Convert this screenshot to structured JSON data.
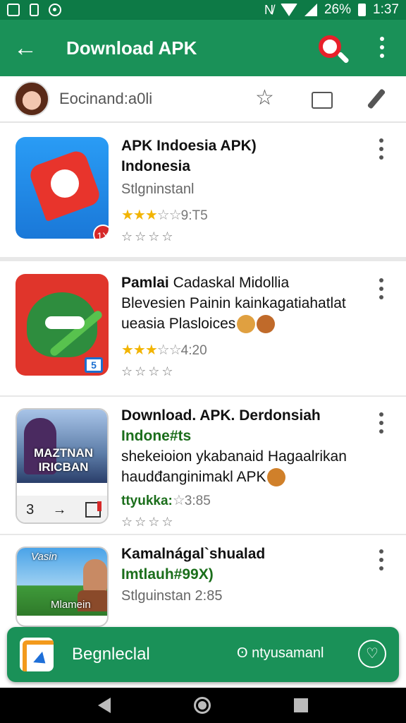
{
  "status_bar": {
    "battery": "26%",
    "time": "1:37"
  },
  "app_bar": {
    "back_icon": "arrow-left-icon",
    "title": "Download APK",
    "search_color": "#e8202a"
  },
  "profile": {
    "name": "Eocinand:a0li"
  },
  "items": [
    {
      "title_lines": [
        "APK Indoesia APK)",
        "Indonesia"
      ],
      "sub": "Stlgninstanl",
      "stars": "★★★",
      "stars_empty": "☆☆",
      "rating_text": "9:T5",
      "gray_stars": "☆☆☆☆",
      "badge": "1X"
    },
    {
      "title_bold": "Pamlai",
      "title_rest": "Cadaskal Midollia",
      "line2": "Blevesien Painin kainkagatiahatlat",
      "line3": "ueasia Plasloices",
      "stars": "★★★",
      "stars_empty": "☆☆",
      "rating_text": "4:20",
      "gray_stars": "☆☆☆☆",
      "thumb_box": "5"
    },
    {
      "title": "Download. APK. Derdonsiah",
      "green_line": "Indone#ts",
      "line3": "shekeioion ykabanaid Hagaalrikan",
      "line4": "haudđanginimakl APK",
      "green_label": "ttyukka:",
      "star_outline": "☆",
      "rating_text": "3:85",
      "gray_stars": "☆☆☆☆",
      "thumb_caption": [
        "MAZTNAN",
        "IRICBAN"
      ],
      "thumb_controls": [
        "3",
        "→"
      ]
    },
    {
      "title": "Kamalnágal`shualad",
      "green_line": "Imtlauh#99X)",
      "sub": "Stlguinstan 2:85",
      "thumb_top": "Vasin",
      "thumb_bottom": "Mlamein"
    }
  ],
  "banner": {
    "label": "Begnleclal",
    "right_text": "ʘ ntyusamanl",
    "heart_icon": "heart-icon"
  }
}
